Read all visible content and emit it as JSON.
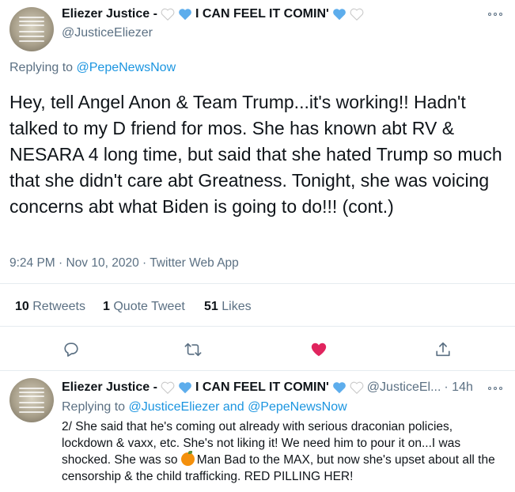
{
  "tweet": {
    "author_name": "Eliezer Justice -",
    "name_suffix": "I CAN FEEL IT COMIN'",
    "handle": "@JusticeEliezer",
    "replying_label": "Replying to",
    "replying_to": "@PepeNewsNow",
    "text": "Hey, tell Angel Anon & Team Trump...it's working!! Hadn't talked to my D friend for mos. She has known abt RV & NESARA 4 long time, but said that she hated Trump so much that she didn't care abt Greatness. Tonight, she was voicing concerns abt what Biden is going to do!!! (cont.)",
    "timestamp": "9:24 PM · Nov 10, 2020 · Twitter Web App",
    "stats": {
      "retweets_count": "10",
      "retweets_label": "Retweets",
      "quotes_count": "1",
      "quotes_label": "Quote Tweet",
      "likes_count": "51",
      "likes_label": "Likes"
    }
  },
  "reply": {
    "author_name": "Eliezer Justice -",
    "name_suffix": "I CAN FEEL IT COMIN'",
    "handle_trunc": "@JusticeEl...",
    "time": "· 14h",
    "replying_label": "Replying to",
    "replying_to_1": "@JusticeEliezer",
    "replying_and": "and",
    "replying_to_2": "@PepeNewsNow",
    "text_part1": "2/ She said that he's coming out already with serious draconian policies, lockdown & vaxx, etc. She's not liking it! We need him to pour it on...I was shocked. She was so",
    "text_part2": "Man Bad to the MAX, but now she's upset about all the censorship & the child trafficking. RED PILLING HER!"
  },
  "icons": {
    "more": "more-dots-icon",
    "reply": "reply-icon",
    "retweet": "retweet-icon",
    "like": "like-heart-icon",
    "share": "share-icon",
    "emoji_heart_white": "white-heart-emoji",
    "emoji_heart_blue": "blue-heart-emoji",
    "emoji_orange": "orange-emoji"
  },
  "colors": {
    "link_blue": "#1b95e0",
    "secondary_text": "#5b7083",
    "like_red": "#e0245e",
    "blue_heart": "#5dadec"
  }
}
